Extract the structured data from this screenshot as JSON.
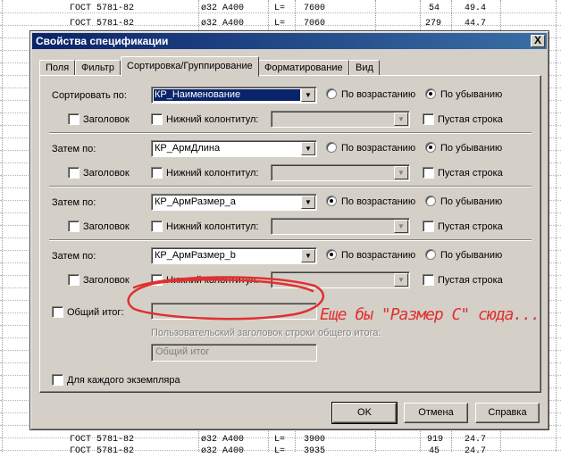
{
  "background_sheet": {
    "top_rows": [
      {
        "gost": "ГОСТ 5781-82",
        "profile": "ø32 A400",
        "l": "L=",
        "length": "7600",
        "count": "54",
        "mass": "49.4"
      },
      {
        "gost": "ГОСТ 5781-82",
        "profile": "ø32 A400",
        "l": "L=",
        "length": "7060",
        "count": "279",
        "mass": "44.7"
      }
    ],
    "bottom_rows": [
      {
        "gost": "ГОСТ 5781-82",
        "profile": "ø32 A400",
        "l": "L=",
        "length": "3900",
        "count": "919",
        "mass": "24.7"
      },
      {
        "gost": "ГОСТ 5781-82",
        "profile": "ø32 A400",
        "l": "L=",
        "length": "3935",
        "count": "45",
        "mass": "24.7"
      }
    ]
  },
  "dialog": {
    "title": "Свойства спецификации",
    "close_label": "X",
    "tabs": [
      {
        "label": "Поля",
        "active": false
      },
      {
        "label": "Фильтр",
        "active": false
      },
      {
        "label": "Сортировка/Группирование",
        "active": true
      },
      {
        "label": "Форматирование",
        "active": false
      },
      {
        "label": "Вид",
        "active": false
      }
    ],
    "sort_groups": [
      {
        "label": "Сортировать по:",
        "field": "КР_Наименование",
        "selected": true,
        "ascending_label": "По возрастанию",
        "descending_label": "По убыванию",
        "order": "descending",
        "header_label": "Заголовок",
        "footer_label": "Нижний колонтитул:",
        "blank_line_label": "Пустая строка"
      },
      {
        "label": "Затем по:",
        "field": "КР_АрмДлина",
        "selected": false,
        "ascending_label": "По возрастанию",
        "descending_label": "По убыванию",
        "order": "descending",
        "header_label": "Заголовок",
        "footer_label": "Нижний колонтитул:",
        "blank_line_label": "Пустая строка"
      },
      {
        "label": "Затем по:",
        "field": "КР_АрмРазмер_а",
        "selected": false,
        "ascending_label": "По возрастанию",
        "descending_label": "По убыванию",
        "order": "ascending",
        "header_label": "Заголовок",
        "footer_label": "Нижний колонтитул:",
        "blank_line_label": "Пустая строка"
      },
      {
        "label": "Затем по:",
        "field": "КР_АрмРазмер_b",
        "selected": false,
        "ascending_label": "По возрастанию",
        "descending_label": "По убыванию",
        "order": "ascending",
        "header_label": "Заголовок",
        "footer_label": "Нижний колонтитул:",
        "blank_line_label": "Пустая строка"
      }
    ],
    "grand_total_label": "Общий итог:",
    "grand_total_value": "",
    "custom_title_label": "Пользовательский заголовок строки общего итога:",
    "custom_title_value": "Общий итог",
    "each_instance_label": "Для каждого экземпляра",
    "buttons": {
      "ok": "OK",
      "cancel": "Отмена",
      "help": "Справка"
    }
  },
  "annotation": {
    "text": "Еще бы \"Размер С\" сюда...",
    "color": "#e03030"
  }
}
